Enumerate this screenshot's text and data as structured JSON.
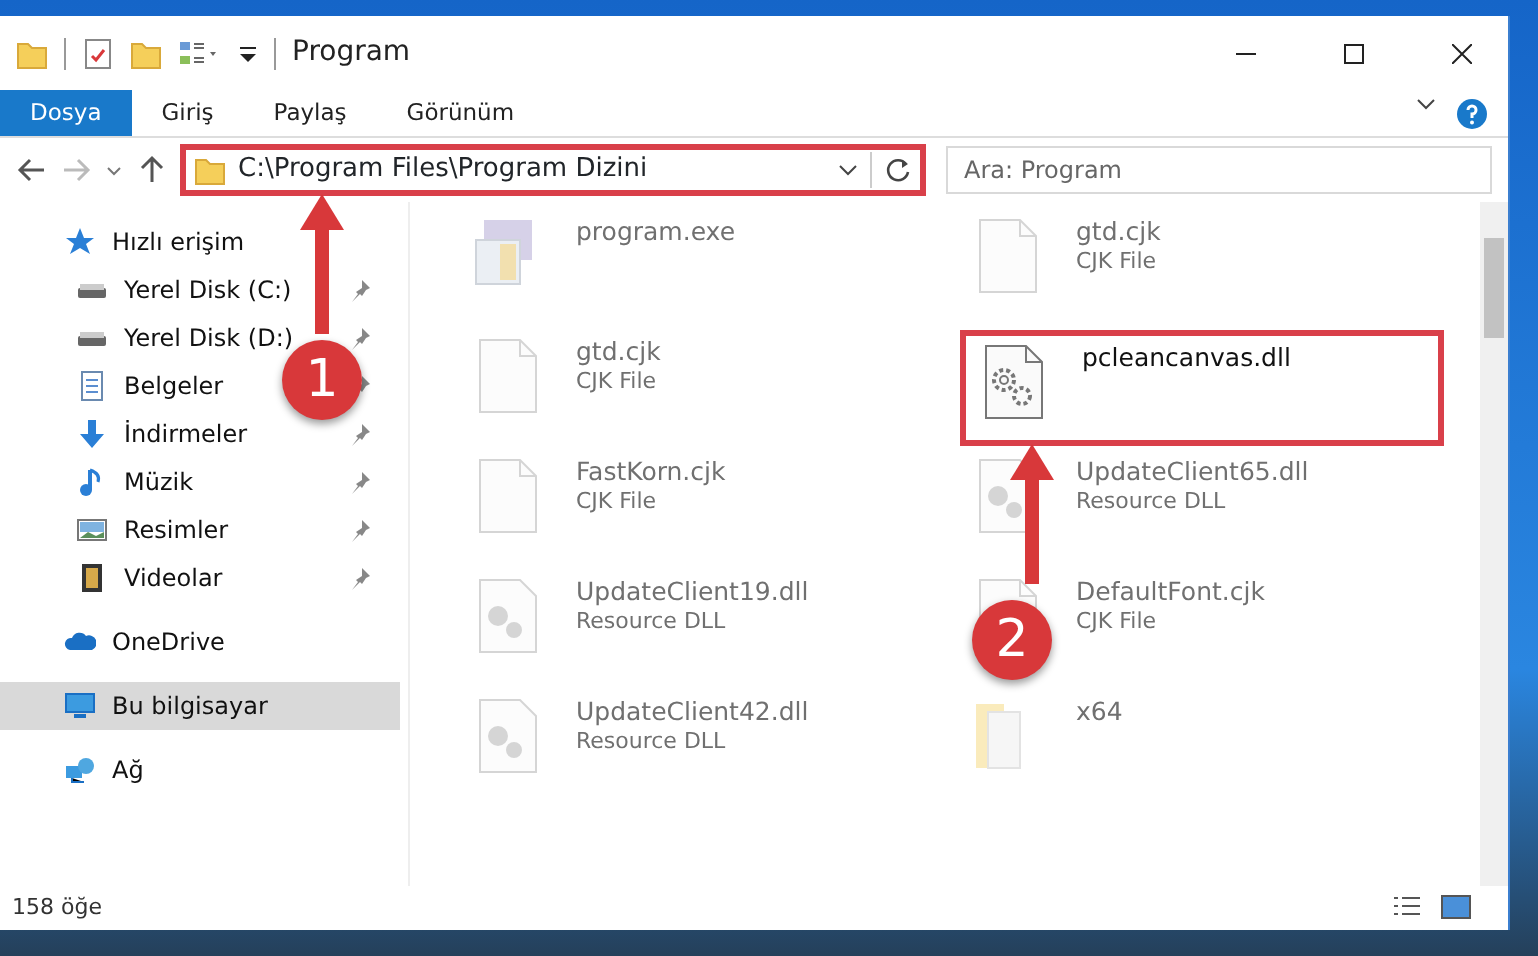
{
  "window": {
    "title": "Program"
  },
  "ribbon_tabs": [
    {
      "label": "Dosya",
      "selected": true
    },
    {
      "label": "Giriş",
      "selected": false
    },
    {
      "label": "Paylaş",
      "selected": false
    },
    {
      "label": "Görünüm",
      "selected": false
    }
  ],
  "address": {
    "path": "C:\\Program Files\\Program Dizini",
    "highlighted": true
  },
  "search": {
    "placeholder": "Ara: Program"
  },
  "nav": [
    {
      "label": "Hızlı erişim",
      "kind": "star",
      "selected": false,
      "children": [
        {
          "label": "Yerel Disk (C:)",
          "kind": "drive",
          "pinned": true,
          "selected": false
        },
        {
          "label": "Yerel Disk (D:)",
          "kind": "drive",
          "pinned": true,
          "selected": false
        },
        {
          "label": "Belgeler",
          "kind": "docs",
          "pinned": true,
          "selected": false
        },
        {
          "label": "İndirmeler",
          "kind": "download",
          "pinned": true,
          "selected": false
        },
        {
          "label": "Müzik",
          "kind": "music",
          "pinned": true,
          "selected": false
        },
        {
          "label": "Resimler",
          "kind": "pictures",
          "pinned": true,
          "selected": false
        },
        {
          "label": "Videolar",
          "kind": "videos",
          "pinned": true,
          "selected": false
        }
      ]
    },
    {
      "label": "OneDrive",
      "kind": "cloud",
      "selected": false
    },
    {
      "label": "Bu bilgisayar",
      "kind": "computer",
      "selected": true
    },
    {
      "label": "Ağ",
      "kind": "network",
      "selected": false
    }
  ],
  "files": [
    {
      "name": "program.exe",
      "kind": "exe",
      "highlighted": false
    },
    {
      "name": "gtd.cjk",
      "type": "CJK File",
      "kind": "blank",
      "highlighted": false
    },
    {
      "name": "gtd.cjk",
      "type": "CJK File",
      "kind": "blank",
      "highlighted": false
    },
    {
      "name": "pcleancanvas.dll",
      "kind": "gear",
      "highlighted": true
    },
    {
      "name": "FastKorn.cjk",
      "type": "CJK File",
      "kind": "blank",
      "highlighted": false
    },
    {
      "name": "UpdateClient65.dll",
      "type": "Resource DLL",
      "kind": "dll",
      "highlighted": false
    },
    {
      "name": "UpdateClient19.dll",
      "type": "Resource DLL",
      "kind": "dll",
      "highlighted": false
    },
    {
      "name": "DefaultFont.cjk",
      "type": "CJK File",
      "kind": "blank",
      "highlighted": false
    },
    {
      "name": "UpdateClient42.dll",
      "type": "Resource DLL",
      "kind": "dll",
      "highlighted": false
    },
    {
      "name": "x64",
      "kind": "folder",
      "highlighted": false
    }
  ],
  "status_bar": {
    "count": "158 öğe"
  },
  "callouts": [
    {
      "number": "1"
    },
    {
      "number": "2"
    }
  ]
}
